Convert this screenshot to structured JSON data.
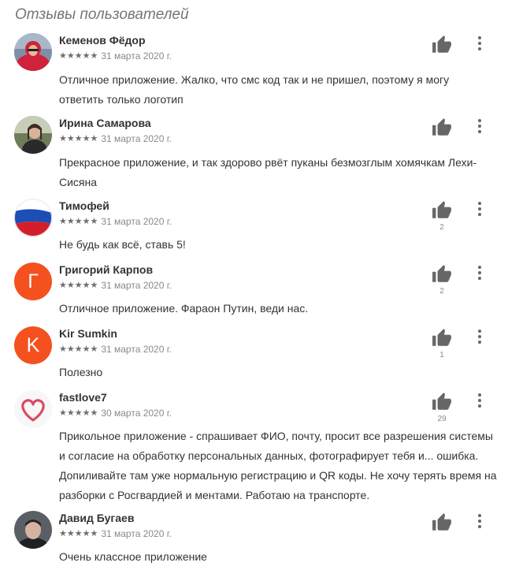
{
  "section_title": "Отзывы пользователей",
  "colors": {
    "star": "#6f6f6f",
    "avatar_orange": "#f4511e",
    "text": "#333333",
    "muted": "#8a8a8a"
  },
  "reviews": [
    {
      "name": "Кеменов Фёдор",
      "rating": 5,
      "stars": "★★★★★",
      "date": "31 марта 2020 г.",
      "text": "Отличное приложение. Жалко, что смс код так и не пришел, поэтому я могу ответить только логотип",
      "likes": "",
      "avatar": "photo-red-jacket"
    },
    {
      "name": "Ирина Самарова",
      "rating": 5,
      "stars": "★★★★★",
      "date": "31 марта 2020 г.",
      "text": "Прекрасное приложение, и так здорово рвёт пуканы безмозглым хомячкам Лехи-Сисяна",
      "likes": "",
      "avatar": "photo-outdoor"
    },
    {
      "name": "Тимофей",
      "rating": 5,
      "stars": "★★★★★",
      "date": "31 марта 2020 г.",
      "text": "Не будь как всё, ставь 5!",
      "likes": "2",
      "avatar": "russian-flag"
    },
    {
      "name": "Григорий Карпов",
      "rating": 5,
      "stars": "★★★★★",
      "date": "31 марта 2020 г.",
      "text": "Отличное приложение. Фараон Путин, веди нас.",
      "likes": "2",
      "avatar_letter": "Г"
    },
    {
      "name": "Kir Sumkin",
      "rating": 5,
      "stars": "★★★★★",
      "date": "31 марта 2020 г.",
      "text": "Полезно",
      "likes": "1",
      "avatar_letter": "K"
    },
    {
      "name": "fastlove7",
      "rating": 5,
      "stars": "★★★★★",
      "date": "30 марта 2020 г.",
      "text": "Прикольное приложение - спрашивает ФИО, почту, просит все разрешения системы и согласие на обработку персональных данных, фотографирует тебя и... ошибка. Допиливайте там уже нормальную регистрацию и QR коды. Не хочу терять время на разборки с Росгвардией и ментами. Работаю на транспорте.",
      "likes": "29",
      "avatar": "heart"
    },
    {
      "name": "Давид Бугаев",
      "rating": 5,
      "stars": "★★★★★",
      "date": "31 марта 2020 г.",
      "text": "Очень классное приложение",
      "likes": "",
      "avatar": "photo-portrait"
    }
  ]
}
